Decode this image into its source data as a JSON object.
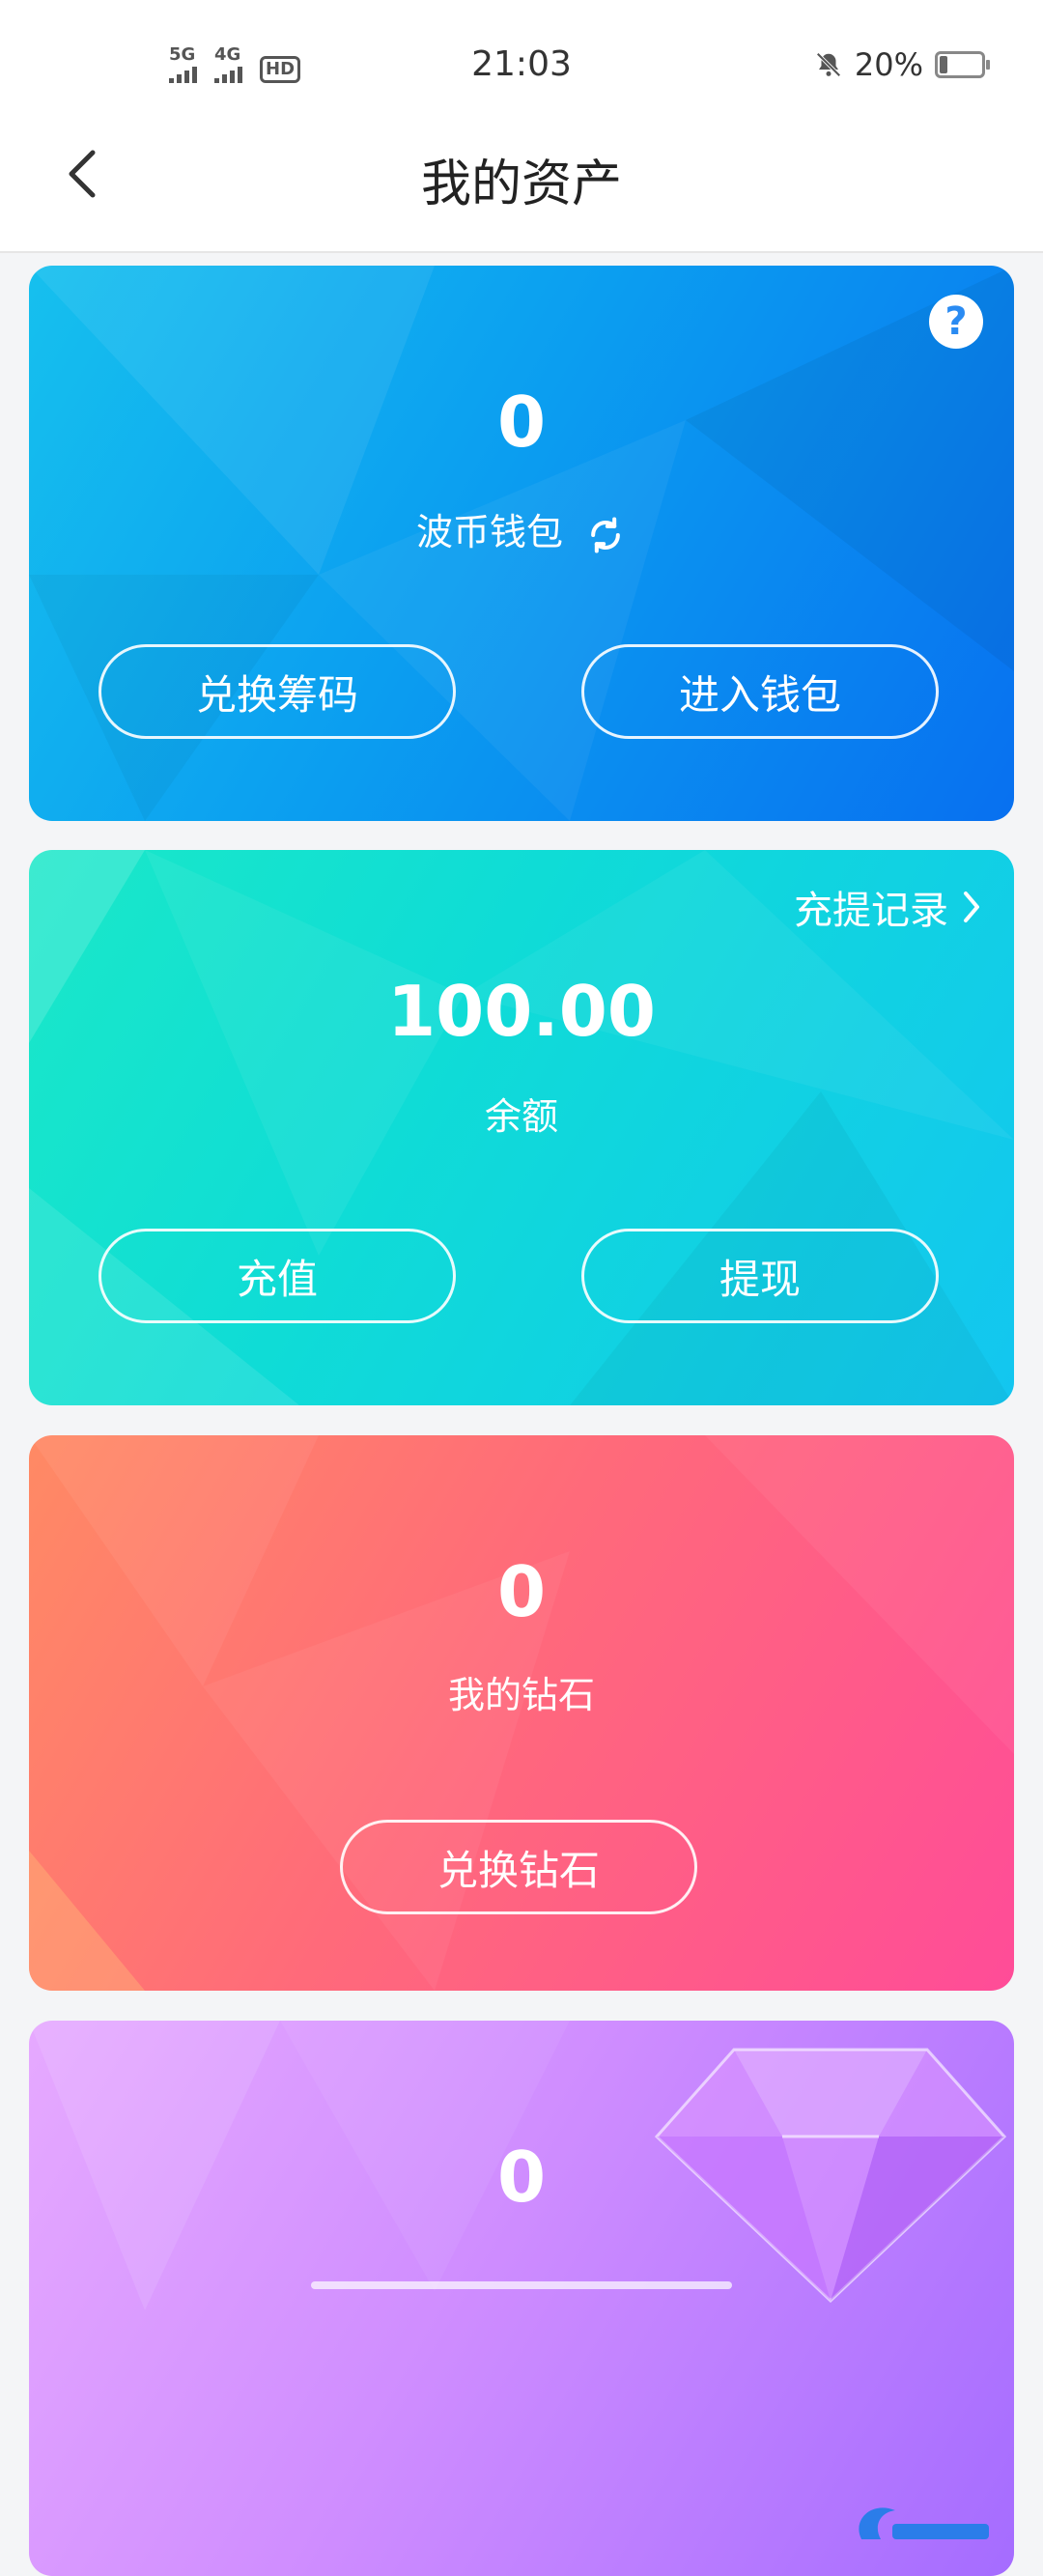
{
  "status_bar": {
    "time": "21:03",
    "battery_percent": "20%",
    "signal1_label": "5G",
    "signal2_label": "4G",
    "hd_label": "HD"
  },
  "header": {
    "title": "我的资产"
  },
  "cards": [
    {
      "value": "0",
      "label": "波币钱包",
      "buttons": [
        "兑换筹码",
        "进入钱包"
      ],
      "colors": [
        "#13b7e9",
        "#0a76ef"
      ]
    },
    {
      "value": "100.00",
      "label": "余额",
      "link": "充提记录",
      "buttons": [
        "充值",
        "提现"
      ],
      "colors": [
        "#16e3c8",
        "#14c8ef"
      ]
    },
    {
      "value": "0",
      "label": "我的钻石",
      "buttons": [
        "兑换钻石"
      ],
      "colors": [
        "#ff7d66",
        "#ff4f95"
      ]
    },
    {
      "value": "0",
      "colors": [
        "#d8a6ff",
        "#b06bff"
      ]
    }
  ]
}
